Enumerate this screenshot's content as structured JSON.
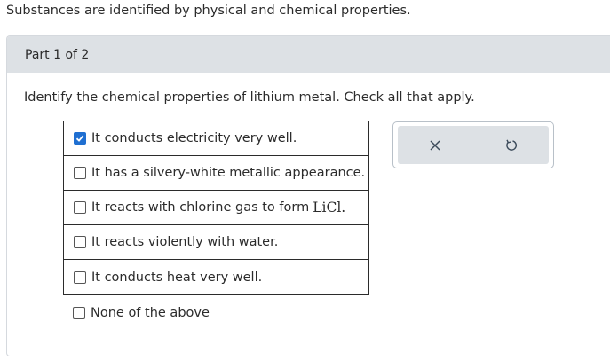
{
  "intro_text": "Substances are identified by physical and chemical properties.",
  "part": {
    "label": "Part 1 of 2"
  },
  "question": "Identify the chemical properties of lithium metal. Check all that apply.",
  "options": [
    {
      "label": "It conducts electricity very well.",
      "checked": true
    },
    {
      "label": "It has a silvery-white metallic appearance.",
      "checked": false
    },
    {
      "label": "It reacts with chlorine gas to form",
      "formula": "LiCl.",
      "checked": false
    },
    {
      "label": "It reacts violently with water.",
      "checked": false
    },
    {
      "label": "It conducts heat very well.",
      "checked": false
    },
    {
      "label": "None of the above",
      "checked": false
    }
  ],
  "toolbar": {
    "clear_icon": "x-icon",
    "undo_icon": "undo-icon"
  },
  "colors": {
    "check_accent": "#1f6fd1",
    "bar_bg": "#dde1e5",
    "icon_color": "#3b4a5a"
  }
}
